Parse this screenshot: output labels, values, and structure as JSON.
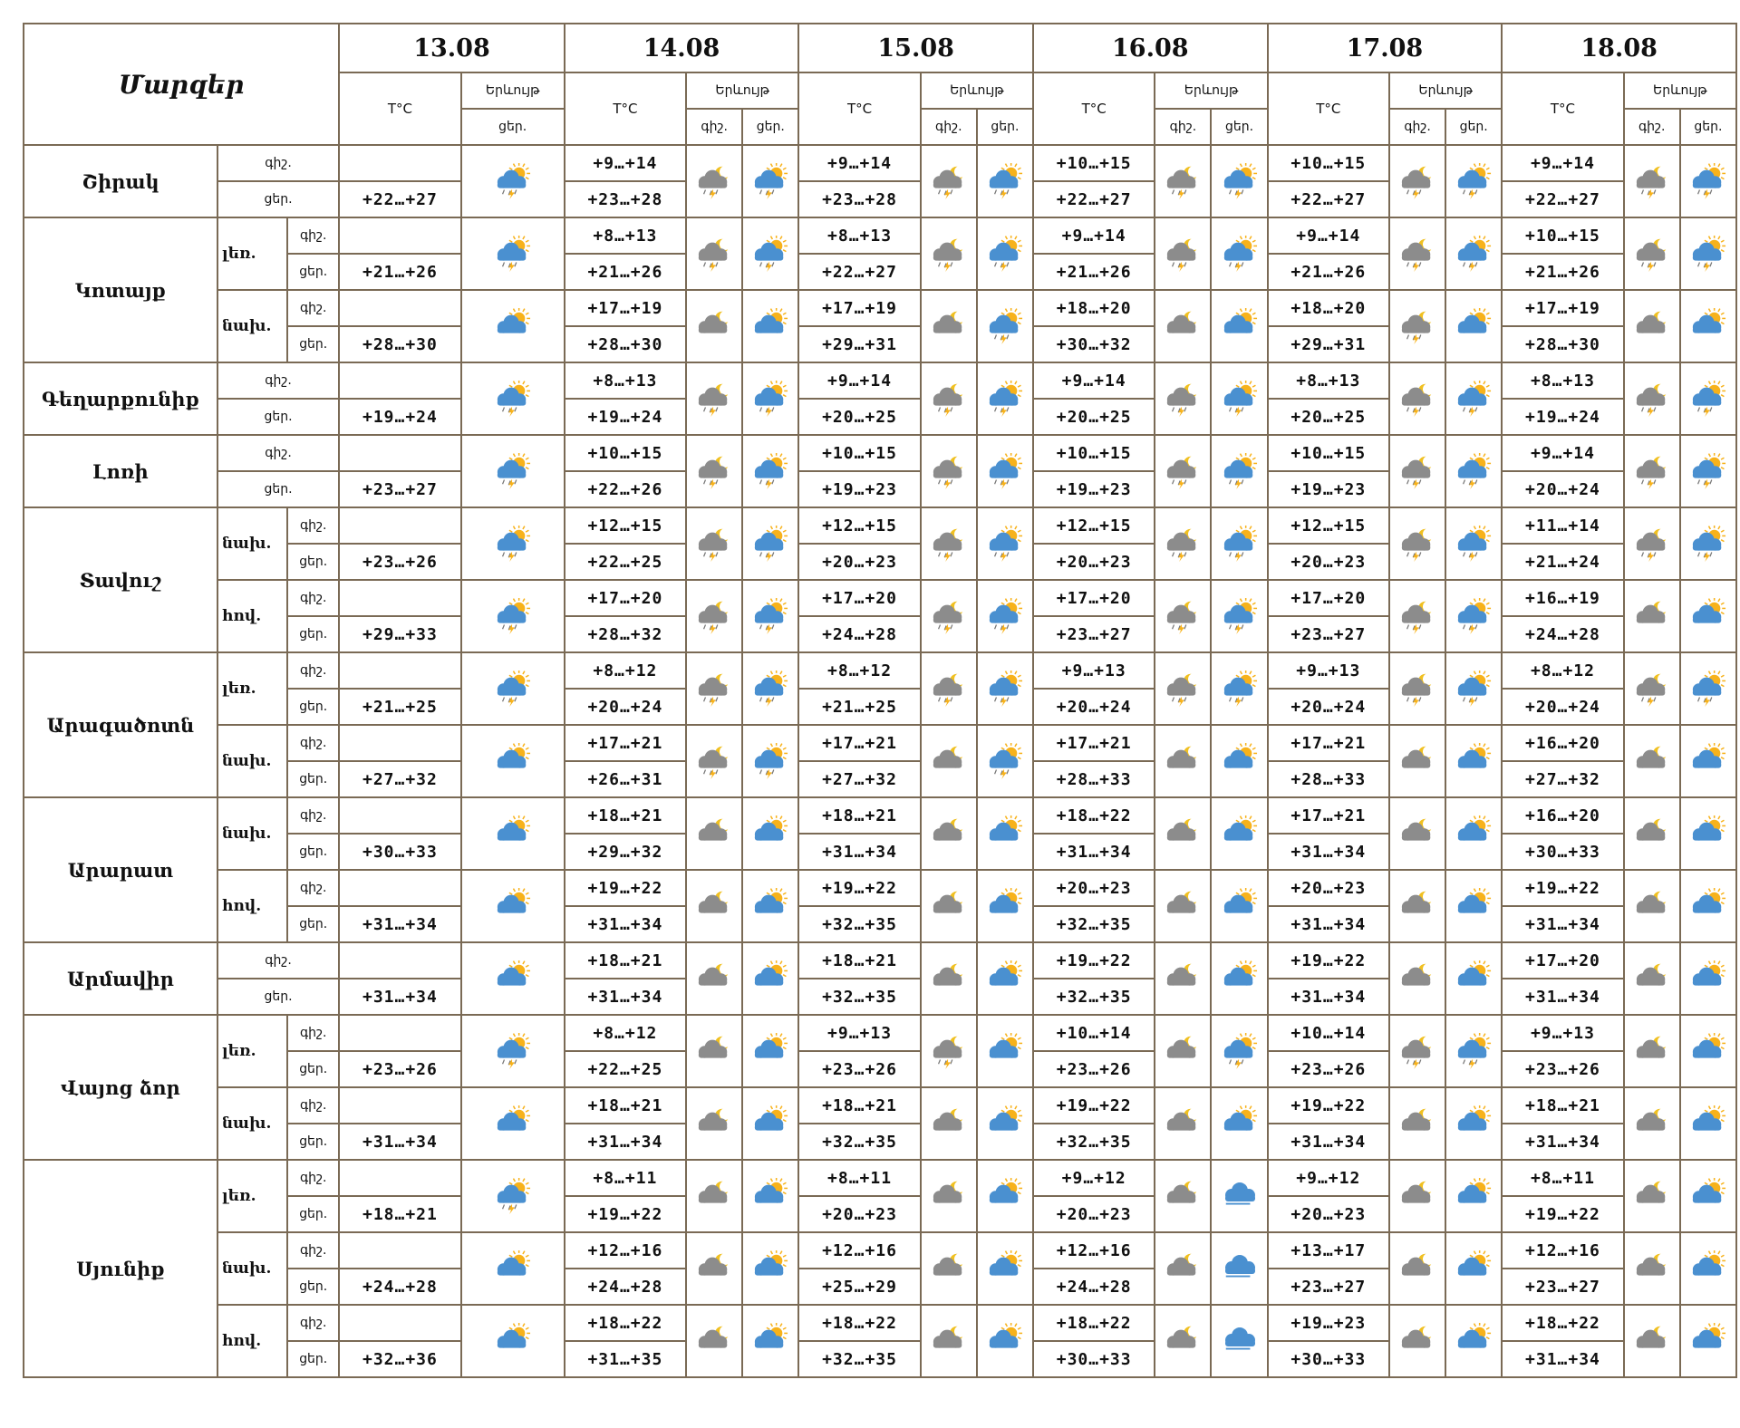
{
  "header": {
    "title": "Մարզեր",
    "temp_label": "T°C",
    "wx_label": "Երևույթ",
    "night": "գիշ.",
    "day": "ցեր.",
    "dates": [
      "13.08",
      "14.08",
      "15.08",
      "16.08",
      "17.08",
      "18.08"
    ]
  },
  "icon_legend": {
    "n_rain": "night-cloud-rain-icon",
    "d_rain": "sun-cloud-rain-icon",
    "n_cloud": "night-cloud-icon",
    "d_cloud": "sun-cloud-icon",
    "cloud_only": "partly-cloudy-icon",
    "colors": {
      "sun": "#f7b21b",
      "cloud_day": "#4a90d0",
      "cloud_night": "#8c8c8c",
      "moon": "#f0c020",
      "border": "#7a6a55"
    }
  },
  "regions": [
    {
      "name": "Շիրակ",
      "groups": [
        {
          "sub": "",
          "first": {
            "n": "",
            "d": "+22…+27",
            "icon": "d_rain"
          },
          "days": [
            {
              "n": "+9…+14",
              "d": "+23…+28",
              "ni": "n_rain",
              "di": "d_rain"
            },
            {
              "n": "+9…+14",
              "d": "+23…+28",
              "ni": "n_rain",
              "di": "d_rain"
            },
            {
              "n": "+10…+15",
              "d": "+22…+27",
              "ni": "n_rain",
              "di": "d_rain"
            },
            {
              "n": "+10…+15",
              "d": "+22…+27",
              "ni": "n_rain",
              "di": "d_rain"
            },
            {
              "n": "+9…+14",
              "d": "+22…+27",
              "ni": "n_rain",
              "di": "d_rain"
            }
          ]
        }
      ]
    },
    {
      "name": "Կոտայք",
      "groups": [
        {
          "sub": "լեռ.",
          "first": {
            "n": "",
            "d": "+21…+26",
            "icon": "d_rain"
          },
          "days": [
            {
              "n": "+8…+13",
              "d": "+21…+26",
              "ni": "n_rain",
              "di": "d_rain"
            },
            {
              "n": "+8…+13",
              "d": "+22…+27",
              "ni": "n_rain",
              "di": "d_rain"
            },
            {
              "n": "+9…+14",
              "d": "+21…+26",
              "ni": "n_rain",
              "di": "d_rain"
            },
            {
              "n": "+9…+14",
              "d": "+21…+26",
              "ni": "n_rain",
              "di": "d_rain"
            },
            {
              "n": "+10…+15",
              "d": "+21…+26",
              "ni": "n_rain",
              "di": "d_rain"
            }
          ]
        },
        {
          "sub": "նախ.",
          "first": {
            "n": "",
            "d": "+28…+30",
            "icon": "d_cloud"
          },
          "days": [
            {
              "n": "+17…+19",
              "d": "+28…+30",
              "ni": "n_cloud",
              "di": "d_cloud"
            },
            {
              "n": "+17…+19",
              "d": "+29…+31",
              "ni": "n_cloud",
              "di": "d_rain"
            },
            {
              "n": "+18…+20",
              "d": "+30…+32",
              "ni": "n_cloud",
              "di": "d_cloud"
            },
            {
              "n": "+18…+20",
              "d": "+29…+31",
              "ni": "n_rain",
              "di": "d_cloud"
            },
            {
              "n": "+17…+19",
              "d": "+28…+30",
              "ni": "n_cloud",
              "di": "d_cloud"
            }
          ]
        }
      ]
    },
    {
      "name": "Գեղարքունիք",
      "groups": [
        {
          "sub": "",
          "first": {
            "n": "",
            "d": "+19…+24",
            "icon": "d_rain"
          },
          "days": [
            {
              "n": "+8…+13",
              "d": "+19…+24",
              "ni": "n_rain",
              "di": "d_rain"
            },
            {
              "n": "+9…+14",
              "d": "+20…+25",
              "ni": "n_rain",
              "di": "d_rain"
            },
            {
              "n": "+9…+14",
              "d": "+20…+25",
              "ni": "n_rain",
              "di": "d_rain"
            },
            {
              "n": "+8…+13",
              "d": "+20…+25",
              "ni": "n_rain",
              "di": "d_rain"
            },
            {
              "n": "+8…+13",
              "d": "+19…+24",
              "ni": "n_rain",
              "di": "d_rain"
            }
          ]
        }
      ]
    },
    {
      "name": "Լոռի",
      "groups": [
        {
          "sub": "",
          "first": {
            "n": "",
            "d": "+23…+27",
            "icon": "d_rain"
          },
          "days": [
            {
              "n": "+10…+15",
              "d": "+22…+26",
              "ni": "n_rain",
              "di": "d_rain"
            },
            {
              "n": "+10…+15",
              "d": "+19…+23",
              "ni": "n_rain",
              "di": "d_rain"
            },
            {
              "n": "+10…+15",
              "d": "+19…+23",
              "ni": "n_rain",
              "di": "d_rain"
            },
            {
              "n": "+10…+15",
              "d": "+19…+23",
              "ni": "n_rain",
              "di": "d_rain"
            },
            {
              "n": "+9…+14",
              "d": "+20…+24",
              "ni": "n_rain",
              "di": "d_rain"
            }
          ]
        }
      ]
    },
    {
      "name": "Տավուշ",
      "groups": [
        {
          "sub": "նախ.",
          "first": {
            "n": "",
            "d": "+23…+26",
            "icon": "d_rain"
          },
          "days": [
            {
              "n": "+12…+15",
              "d": "+22…+25",
              "ni": "n_rain",
              "di": "d_rain"
            },
            {
              "n": "+12…+15",
              "d": "+20…+23",
              "ni": "n_rain",
              "di": "d_rain"
            },
            {
              "n": "+12…+15",
              "d": "+20…+23",
              "ni": "n_rain",
              "di": "d_rain"
            },
            {
              "n": "+12…+15",
              "d": "+20…+23",
              "ni": "n_rain",
              "di": "d_rain"
            },
            {
              "n": "+11…+14",
              "d": "+21…+24",
              "ni": "n_rain",
              "di": "d_rain"
            }
          ]
        },
        {
          "sub": "հով.",
          "first": {
            "n": "",
            "d": "+29…+33",
            "icon": "d_rain"
          },
          "days": [
            {
              "n": "+17…+20",
              "d": "+28…+32",
              "ni": "n_rain",
              "di": "d_rain"
            },
            {
              "n": "+17…+20",
              "d": "+24…+28",
              "ni": "n_rain",
              "di": "d_rain"
            },
            {
              "n": "+17…+20",
              "d": "+23…+27",
              "ni": "n_rain",
              "di": "d_rain"
            },
            {
              "n": "+17…+20",
              "d": "+23…+27",
              "ni": "n_rain",
              "di": "d_rain"
            },
            {
              "n": "+16…+19",
              "d": "+24…+28",
              "ni": "n_cloud",
              "di": "d_cloud"
            }
          ]
        }
      ]
    },
    {
      "name": "Արագածոտն",
      "groups": [
        {
          "sub": "լեռ.",
          "first": {
            "n": "",
            "d": "+21…+25",
            "icon": "d_rain"
          },
          "days": [
            {
              "n": "+8…+12",
              "d": "+20…+24",
              "ni": "n_rain",
              "di": "d_rain"
            },
            {
              "n": "+8…+12",
              "d": "+21…+25",
              "ni": "n_rain",
              "di": "d_rain"
            },
            {
              "n": "+9…+13",
              "d": "+20…+24",
              "ni": "n_rain",
              "di": "d_rain"
            },
            {
              "n": "+9…+13",
              "d": "+20…+24",
              "ni": "n_rain",
              "di": "d_rain"
            },
            {
              "n": "+8…+12",
              "d": "+20…+24",
              "ni": "n_rain",
              "di": "d_rain"
            }
          ]
        },
        {
          "sub": "նախ.",
          "first": {
            "n": "",
            "d": "+27…+32",
            "icon": "d_cloud"
          },
          "days": [
            {
              "n": "+17…+21",
              "d": "+26…+31",
              "ni": "n_rain",
              "di": "d_rain"
            },
            {
              "n": "+17…+21",
              "d": "+27…+32",
              "ni": "n_cloud",
              "di": "d_rain"
            },
            {
              "n": "+17…+21",
              "d": "+28…+33",
              "ni": "n_cloud",
              "di": "d_cloud"
            },
            {
              "n": "+17…+21",
              "d": "+28…+33",
              "ni": "n_cloud",
              "di": "d_cloud"
            },
            {
              "n": "+16…+20",
              "d": "+27…+32",
              "ni": "n_cloud",
              "di": "d_cloud"
            }
          ]
        }
      ]
    },
    {
      "name": "Արարատ",
      "groups": [
        {
          "sub": "նախ.",
          "first": {
            "n": "",
            "d": "+30…+33",
            "icon": "d_cloud"
          },
          "days": [
            {
              "n": "+18…+21",
              "d": "+29…+32",
              "ni": "n_cloud",
              "di": "d_cloud"
            },
            {
              "n": "+18…+21",
              "d": "+31…+34",
              "ni": "n_cloud",
              "di": "d_cloud"
            },
            {
              "n": "+18…+22",
              "d": "+31…+34",
              "ni": "n_cloud",
              "di": "d_cloud"
            },
            {
              "n": "+17…+21",
              "d": "+31…+34",
              "ni": "n_cloud",
              "di": "d_cloud"
            },
            {
              "n": "+16…+20",
              "d": "+30…+33",
              "ni": "n_cloud",
              "di": "d_cloud"
            }
          ]
        },
        {
          "sub": "հով.",
          "first": {
            "n": "",
            "d": "+31…+34",
            "icon": "d_cloud"
          },
          "days": [
            {
              "n": "+19…+22",
              "d": "+31…+34",
              "ni": "n_cloud",
              "di": "d_cloud"
            },
            {
              "n": "+19…+22",
              "d": "+32…+35",
              "ni": "n_cloud",
              "di": "d_cloud"
            },
            {
              "n": "+20…+23",
              "d": "+32…+35",
              "ni": "n_cloud",
              "di": "d_cloud"
            },
            {
              "n": "+20…+23",
              "d": "+31…+34",
              "ni": "n_cloud",
              "di": "d_cloud"
            },
            {
              "n": "+19…+22",
              "d": "+31…+34",
              "ni": "n_cloud",
              "di": "d_cloud"
            }
          ]
        }
      ]
    },
    {
      "name": "Արմավիր",
      "groups": [
        {
          "sub": "",
          "first": {
            "n": "",
            "d": "+31…+34",
            "icon": "d_cloud"
          },
          "days": [
            {
              "n": "+18…+21",
              "d": "+31…+34",
              "ni": "n_cloud",
              "di": "d_cloud"
            },
            {
              "n": "+18…+21",
              "d": "+32…+35",
              "ni": "n_cloud",
              "di": "d_cloud"
            },
            {
              "n": "+19…+22",
              "d": "+32…+35",
              "ni": "n_cloud",
              "di": "d_cloud"
            },
            {
              "n": "+19…+22",
              "d": "+31…+34",
              "ni": "n_cloud",
              "di": "d_cloud"
            },
            {
              "n": "+17…+20",
              "d": "+31…+34",
              "ni": "n_cloud",
              "di": "d_cloud"
            }
          ]
        }
      ]
    },
    {
      "name": "Վայոց ձոր",
      "groups": [
        {
          "sub": "լեռ.",
          "first": {
            "n": "",
            "d": "+23…+26",
            "icon": "d_rain"
          },
          "days": [
            {
              "n": "+8…+12",
              "d": "+22…+25",
              "ni": "n_cloud",
              "di": "d_cloud"
            },
            {
              "n": "+9…+13",
              "d": "+23…+26",
              "ni": "n_rain",
              "di": "d_cloud"
            },
            {
              "n": "+10…+14",
              "d": "+23…+26",
              "ni": "n_cloud",
              "di": "d_rain"
            },
            {
              "n": "+10…+14",
              "d": "+23…+26",
              "ni": "n_rain",
              "di": "d_rain"
            },
            {
              "n": "+9…+13",
              "d": "+23…+26",
              "ni": "n_cloud",
              "di": "d_cloud"
            }
          ]
        },
        {
          "sub": "նախ.",
          "first": {
            "n": "",
            "d": "+31…+34",
            "icon": "d_cloud"
          },
          "days": [
            {
              "n": "+18…+21",
              "d": "+31…+34",
              "ni": "n_cloud",
              "di": "d_cloud"
            },
            {
              "n": "+18…+21",
              "d": "+32…+35",
              "ni": "n_cloud",
              "di": "d_cloud"
            },
            {
              "n": "+19…+22",
              "d": "+32…+35",
              "ni": "n_cloud",
              "di": "d_cloud"
            },
            {
              "n": "+19…+22",
              "d": "+31…+34",
              "ni": "n_cloud",
              "di": "d_cloud"
            },
            {
              "n": "+18…+21",
              "d": "+31…+34",
              "ni": "n_cloud",
              "di": "d_cloud"
            }
          ]
        }
      ]
    },
    {
      "name": "Սյունիք",
      "groups": [
        {
          "sub": "լեռ.",
          "first": {
            "n": "",
            "d": "+18…+21",
            "icon": "d_rain"
          },
          "days": [
            {
              "n": "+8…+11",
              "d": "+19…+22",
              "ni": "n_cloud",
              "di": "d_cloud"
            },
            {
              "n": "+8…+11",
              "d": "+20…+23",
              "ni": "n_cloud",
              "di": "d_cloud"
            },
            {
              "n": "+9…+12",
              "d": "+20…+23",
              "ni": "n_cloud",
              "di": "cloud_only"
            },
            {
              "n": "+9…+12",
              "d": "+20…+23",
              "ni": "n_cloud",
              "di": "d_cloud"
            },
            {
              "n": "+8…+11",
              "d": "+19…+22",
              "ni": "n_cloud",
              "di": "d_cloud"
            }
          ]
        },
        {
          "sub": "նախ.",
          "first": {
            "n": "",
            "d": "+24…+28",
            "icon": "d_cloud"
          },
          "days": [
            {
              "n": "+12…+16",
              "d": "+24…+28",
              "ni": "n_cloud",
              "di": "d_cloud"
            },
            {
              "n": "+12…+16",
              "d": "+25…+29",
              "ni": "n_cloud",
              "di": "d_cloud"
            },
            {
              "n": "+12…+16",
              "d": "+24…+28",
              "ni": "n_cloud",
              "di": "cloud_only"
            },
            {
              "n": "+13…+17",
              "d": "+23…+27",
              "ni": "n_cloud",
              "di": "d_cloud"
            },
            {
              "n": "+12…+16",
              "d": "+23…+27",
              "ni": "n_cloud",
              "di": "d_cloud"
            }
          ]
        },
        {
          "sub": "հով.",
          "first": {
            "n": "",
            "d": "+32…+36",
            "icon": "d_cloud"
          },
          "days": [
            {
              "n": "+18…+22",
              "d": "+31…+35",
              "ni": "n_cloud",
              "di": "d_cloud"
            },
            {
              "n": "+18…+22",
              "d": "+32…+35",
              "ni": "n_cloud",
              "di": "d_cloud"
            },
            {
              "n": "+18…+22",
              "d": "+30…+33",
              "ni": "n_cloud",
              "di": "cloud_only"
            },
            {
              "n": "+19…+23",
              "d": "+30…+33",
              "ni": "n_cloud",
              "di": "d_cloud"
            },
            {
              "n": "+18…+22",
              "d": "+31…+34",
              "ni": "n_cloud",
              "di": "d_cloud"
            }
          ]
        }
      ]
    }
  ]
}
